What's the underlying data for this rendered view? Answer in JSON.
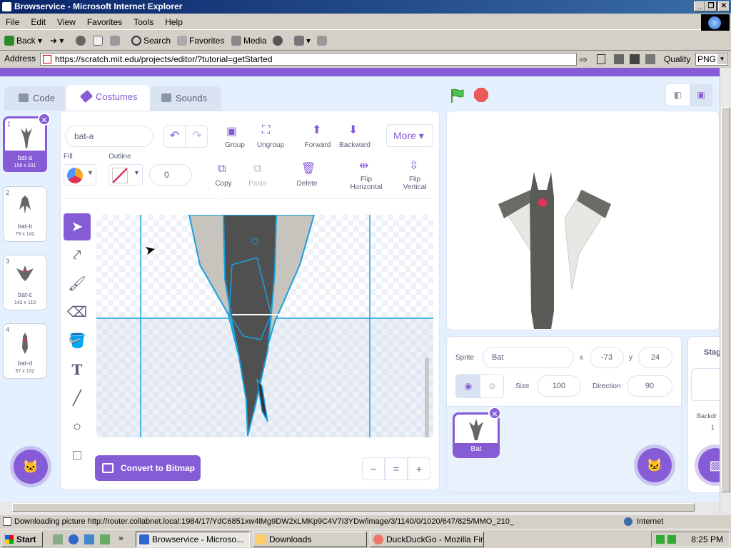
{
  "window": {
    "title": "Browservice - Microsoft Internet Explorer",
    "min": "_",
    "max": "❐",
    "close": "✕"
  },
  "menu": [
    "File",
    "Edit",
    "View",
    "Favorites",
    "Tools",
    "Help"
  ],
  "toolbar": {
    "back": "Back",
    "search": "Search",
    "favorites": "Favorites",
    "media": "Media"
  },
  "address": {
    "label": "Address",
    "url": "https://scratch.mit.edu/projects/editor/?tutorial=getStarted",
    "quality_label": "Quality",
    "quality_value": "PNG"
  },
  "scratch": {
    "tabs": {
      "code": "Code",
      "costumes": "Costumes",
      "sounds": "Sounds"
    },
    "costumes": [
      {
        "num": "1",
        "name": "bat-a",
        "size": "158 x 331"
      },
      {
        "num": "2",
        "name": "bat-b",
        "size": "79 x 142"
      },
      {
        "num": "3",
        "name": "bat-c",
        "size": "142 x 110"
      },
      {
        "num": "4",
        "name": "bat-d",
        "size": "57 x 132"
      }
    ],
    "editor": {
      "costume_name": "bat-a",
      "group": "Group",
      "ungroup": "Ungroup",
      "forward": "Forward",
      "backward": "Backward",
      "more": "More",
      "fill": "Fill",
      "outline": "Outline",
      "outline_width": "0",
      "copy": "Copy",
      "paste": "Paste",
      "delete": "Delete",
      "flip_h": "Flip Horizontal",
      "flip_v": "Flip Vertical",
      "convert": "Convert to Bitmap",
      "zoom_out": "−",
      "zoom_reset": "=",
      "zoom_in": "+"
    },
    "sprite": {
      "label": "Sprite",
      "name": "Bat",
      "x_label": "x",
      "x": "-73",
      "y_label": "y",
      "y": "24",
      "size_label": "Size",
      "size": "100",
      "direction_label": "Direction",
      "direction": "90",
      "tile_name": "Bat"
    },
    "stage_panel": {
      "title": "Stag",
      "backdrops_label": "Backdr",
      "backdrops_count": "1"
    }
  },
  "status": {
    "text": "Downloading picture http://router.collabnet.local:1984/17/YdC6851xw4lMg9DW2xLMKp9C4V7I3YDw/image/3/1140/0/1020/647/825/MMO_210_",
    "zone": "Internet"
  },
  "taskbar": {
    "start": "Start",
    "tasks": [
      "Browservice - Microso...",
      "Downloads",
      "DuckDuckGo - Mozilla Fire..."
    ],
    "time": "8:25 PM"
  },
  "colors": {
    "scratch_purple": "#855cd6",
    "title_blue": "#0a246a",
    "canvas_outline": "#1aa0e0"
  }
}
